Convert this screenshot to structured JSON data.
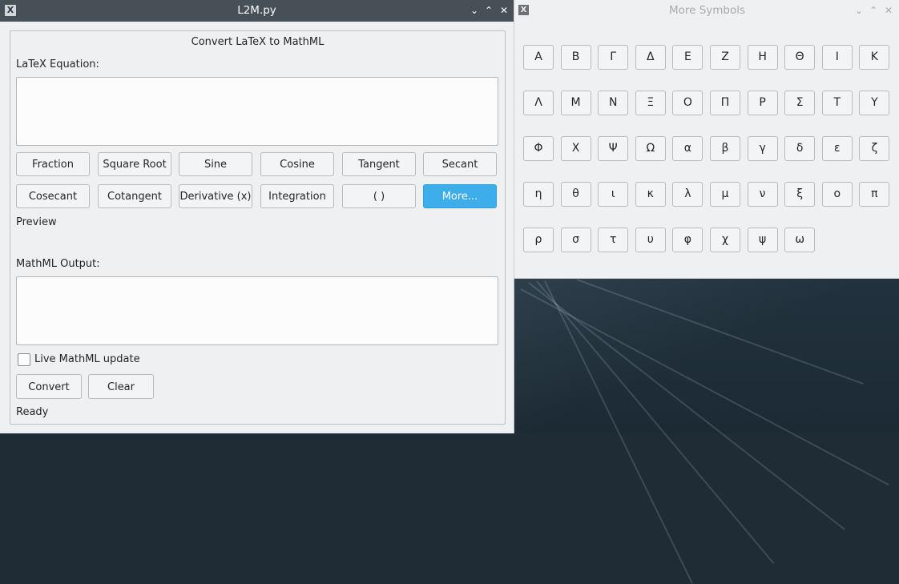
{
  "main_window": {
    "title": "L2M.py",
    "app_icon": "x-window-icon",
    "controls": {
      "minimize": "⌄",
      "maximize": "⌃",
      "close": "✕"
    },
    "group_title": "Convert LaTeX to MathML",
    "latex_label": "LaTeX Equation:",
    "latex_value": "",
    "buttons_row1": [
      "Fraction",
      "Square Root",
      "Sine",
      "Cosine",
      "Tangent",
      "Secant"
    ],
    "buttons_row2": [
      "Cosecant",
      "Cotangent",
      "Derivative (x)",
      "Integration",
      "( )",
      "More..."
    ],
    "preview_label": "Preview",
    "mathml_label": "MathML Output:",
    "mathml_value": "",
    "live_update_label": "Live MathML update",
    "live_update_checked": false,
    "convert_label": "Convert",
    "clear_label": "Clear",
    "status": "Ready",
    "accent_color": "#3daee9"
  },
  "symbols_window": {
    "title": "More Symbols",
    "controls": {
      "minimize": "⌄",
      "maximize": "⌃",
      "close": "✕"
    },
    "rows": [
      [
        "Α",
        "Β",
        "Γ",
        "Δ",
        "Ε",
        "Ζ",
        "Η",
        "Θ",
        "Ι",
        "Κ"
      ],
      [
        "Λ",
        "Μ",
        "Ν",
        "Ξ",
        "Ο",
        "Π",
        "Ρ",
        "Σ",
        "Τ",
        "Υ"
      ],
      [
        "Φ",
        "Χ",
        "Ψ",
        "Ω",
        "α",
        "β",
        "γ",
        "δ",
        "ε",
        "ζ"
      ],
      [
        "η",
        "θ",
        "ι",
        "κ",
        "λ",
        "μ",
        "ν",
        "ξ",
        "ο",
        "π"
      ],
      [
        "ρ",
        "σ",
        "τ",
        "υ",
        "φ",
        "χ",
        "ψ",
        "ω"
      ]
    ]
  }
}
